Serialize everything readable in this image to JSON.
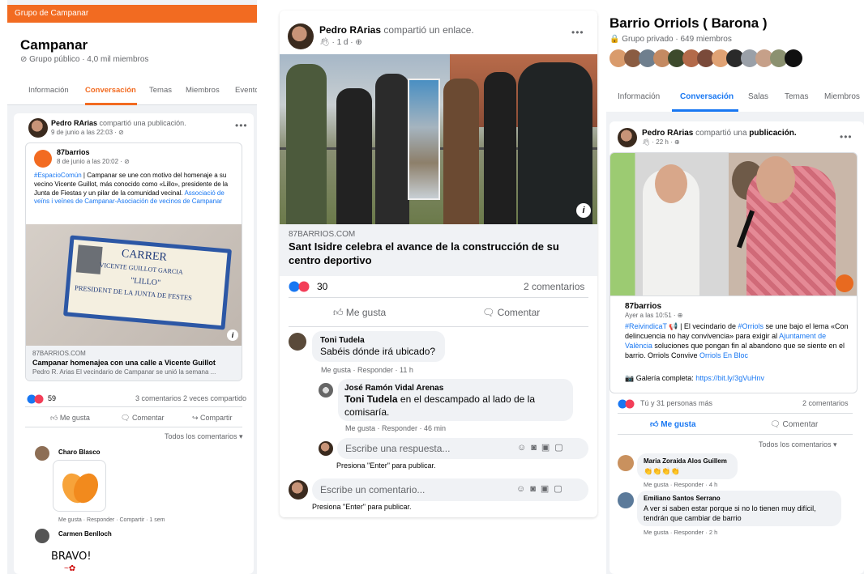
{
  "p1": {
    "header": "Grupo de Campanar",
    "title": "Campanar",
    "subtitle": "⊘ Grupo público · 4,0 mil miembros",
    "tabs": [
      "Información",
      "Conversación",
      "Temas",
      "Miembros",
      "Evento"
    ],
    "post": {
      "author": "Pedro RArias",
      "action": " compartió una publicación.",
      "time": "9 de junio a las 22:03 · ⊘",
      "shared_author": "87barrios",
      "shared_time": "8 de junio a las 20:02 · ⊘",
      "shared_text_tag": "#EspacioComún",
      "shared_text": " | Campanar se une con motivo del homenaje a su vecino Vicente Guillot, más conocido como «Lillo», presidente de la Junta de Fiestas y un pilar de la comunidad vecinal. ",
      "shared_link": "Associació de veïns i veïnes de Campanar-Asociación de vecinos de Campanar",
      "sign_lines": [
        "CARRER",
        "VICENTE GUILLOT GARCIA",
        "\"LILLO\"",
        "PRESIDENT DE LA JUNTA DE FESTES"
      ],
      "domain": "87BARRIOS.COM",
      "link_title": "Campanar homenajea con una calle a Vicente Guillot",
      "link_desc": "Pedro R. Arias El vecindario de Campanar se unió la semana ...",
      "reactions": "59",
      "stats": "3 comentarios  2 veces compartido",
      "like": "Me gusta",
      "comment": "Comentar",
      "share": "Compartir",
      "all_comments": "Todos los comentarios ▾",
      "c1_author": "Charo Blasco",
      "c1_actions": "Me gusta · Responder · Compartir · 1 sem",
      "c2_author": "Carmen Benlloch",
      "c2_text": "BRAVO!"
    }
  },
  "p2": {
    "author": "Pedro RArias",
    "action": " compartió un enlace.",
    "time": "· 1 d · ⊕",
    "domain": "87BARRIOS.COM",
    "title": "Sant Isidre celebra el avance de la construcción de su centro deportivo",
    "reactions": "30",
    "comments_count": "2 comentarios",
    "like": "Me gusta",
    "comment": "Comentar",
    "c1_author": "Toni Tudela",
    "c1_text": "Sabéis dónde irá ubicado?",
    "c1_actions": "Me gusta · Responder · 11 h",
    "r1_author": "José Ramón Vidal Arenas",
    "r1_mention": "Toni Tudela",
    "r1_text": " en el descampado al lado de la comisaría.",
    "r1_actions": "Me gusta · Responder · 46 min",
    "reply_placeholder": "Escribe una respuesta...",
    "press_enter": "Presiona \"Enter\" para publicar.",
    "comment_placeholder": "Escribe un comentario...",
    "press_enter2": "Presiona \"Enter\" para publicar."
  },
  "p3": {
    "title": "Barrio Orriols ( Barona )",
    "subtitle": "🔒 Grupo privado · 649 miembros",
    "tabs": [
      "Información",
      "Conversación",
      "Salas",
      "Temas",
      "Miembros"
    ],
    "post": {
      "author": "Pedro RArias",
      "action": " compartió una ",
      "action_bold": "publicación.",
      "time": "· 22 h · ⊕",
      "shared_author": "87barrios",
      "shared_time": "Ayer a las 10:51 · ⊕",
      "tag1": "#ReivindicaT",
      "text1": " 📢 | El vecindario de ",
      "tag2": "#Orriols",
      "text2": " se une bajo el lema «Con delincuencia no hay convivencia» para exigir al ",
      "link1": "Ajuntament de València",
      "text3": " soluciones que pongan fin al abandono que se siente en el barrio. Orriols Convive ",
      "link2": "Orriols En Bloc",
      "gallery_label": "📷 Galería completa: ",
      "gallery_link": "https://bit.ly/3gVuHnv",
      "reactions": "Tú y 31 personas más",
      "comments_count": "2 comentarios",
      "like": "Me gusta",
      "comment": "Comentar",
      "all_comments": "Todos los comentarios ▾",
      "c1_author": "Maria Zoraida Alos Guillem",
      "c1_text": "👏👏👏👏",
      "c1_actions": "Me gusta · Responder · 4 h",
      "c2_author": "Emiliano Santos Serrano",
      "c2_text": "A ver si saben estar porque si no lo tienen muy difícil, tendrán que cambiar de barrio",
      "c2_actions": "Me gusta · Responder · 2 h"
    }
  },
  "colors": {
    "accent": "#f26b21",
    "fb_blue": "#1877f2",
    "link": "#385898"
  }
}
